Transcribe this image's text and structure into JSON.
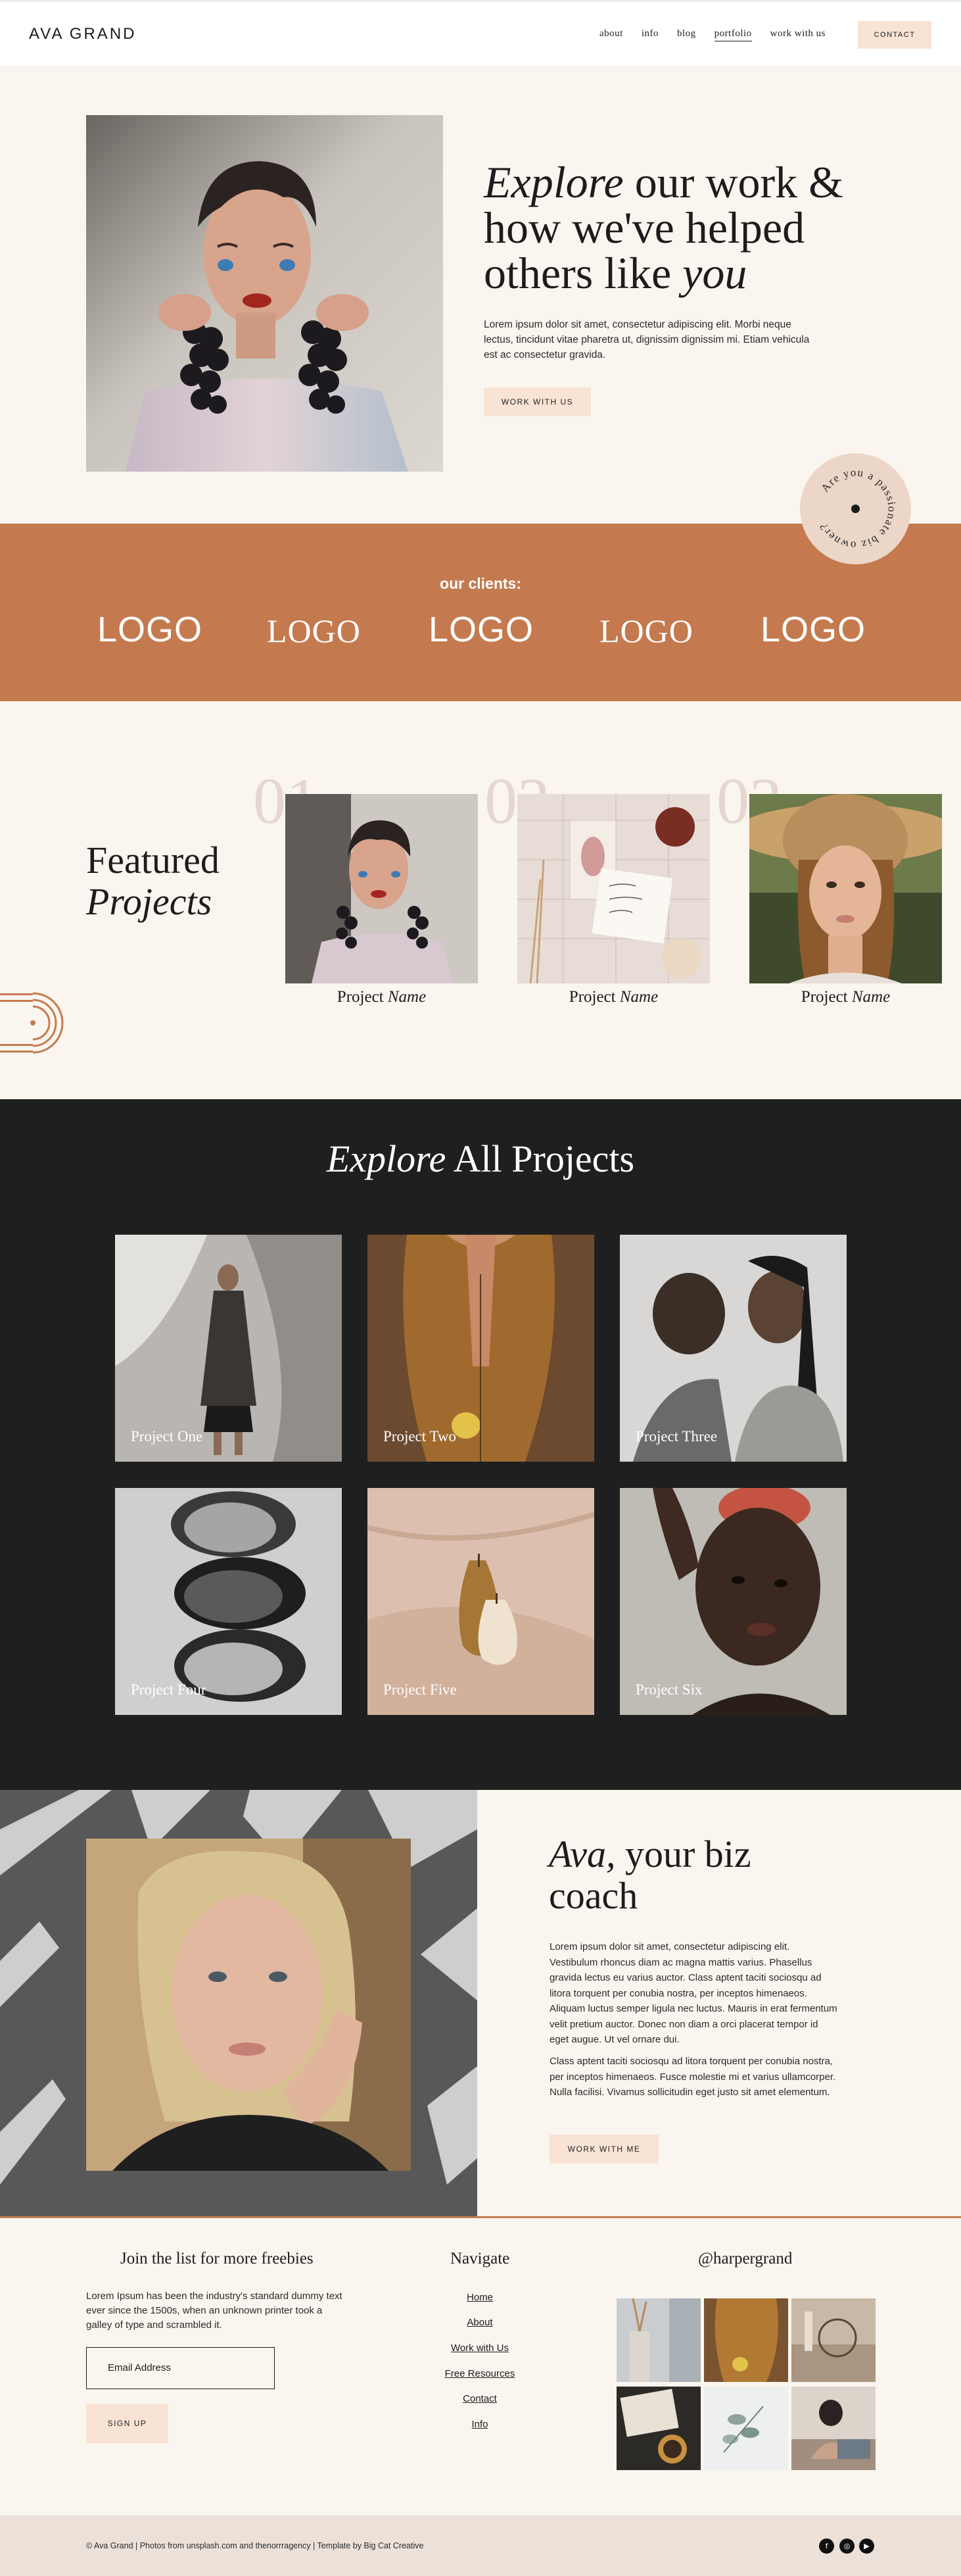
{
  "header": {
    "brand": "AVA GRAND",
    "nav": [
      "about",
      "info",
      "blog",
      "portfolio",
      "work with us"
    ],
    "active_nav": "portfolio",
    "contact_label": "CONTACT"
  },
  "hero": {
    "title_italic_1": "Explore",
    "title_line_1": " our work &",
    "title_line_2": "how we've helped",
    "title_line_3": "others like ",
    "title_italic_2": "you",
    "paragraph": "Lorem ipsum dolor sit amet, consectetur adipiscing elit. Morbi neque lectus, tincidunt vitae pharetra ut, dignissim dignissim mi. Etiam vehicula est ac consectetur gravida.",
    "button_label": "WORK WITH US",
    "badge_text": "Are you a passionate biz owner?"
  },
  "clients": {
    "title": "our clients:",
    "logos": [
      "LOGO",
      "LOGO",
      "LOGO",
      "LOGO",
      "LOGO"
    ]
  },
  "featured": {
    "title_line_1": "Featured",
    "title_line_2": "Projects",
    "items": [
      {
        "num": "01",
        "label": "Project ",
        "label_italic": "Name"
      },
      {
        "num": "02",
        "label": "Project ",
        "label_italic": "Name"
      },
      {
        "num": "03",
        "label": "Project ",
        "label_italic": "Name"
      }
    ]
  },
  "explore": {
    "title_italic": "Explore",
    "title_rest": " All Projects",
    "projects": [
      "Project One",
      "Project Two",
      "Project Three",
      "Project Four",
      "Project Five",
      "Project Six"
    ]
  },
  "coach": {
    "title_italic": "Ava,",
    "title_rest": " your biz",
    "title_line_2": "coach",
    "paragraph_1": "Lorem ipsum dolor sit amet, consectetur adipiscing elit. Vestibulum rhoncus diam ac magna mattis varius. Phasellus gravida lectus eu varius auctor. Class aptent taciti sociosqu ad litora torquent per conubia nostra, per inceptos himenaeos. Aliquam luctus semper ligula nec luctus. Mauris in erat fermentum velit pretium auctor. Donec non diam a orci placerat tempor id eget augue. Ut vel ornare dui.",
    "paragraph_2": "Class aptent taciti sociosqu ad litora torquent per conubia nostra, per inceptos himenaeos. Fusce molestie mi et varius ullamcorper. Nulla facilisi. Vivamus sollicitudin eget justo sit amet elementum.",
    "button_label": "WORK WITH ME"
  },
  "footer": {
    "newsletter_title": "Join the list for more freebies",
    "newsletter_text": "Lorem Ipsum has been the industry's standard dummy text ever since the 1500s, when an unknown printer took a galley of type and scrambled it.",
    "email_placeholder": "Email Address",
    "signup_label": "SIGN UP",
    "navigate_title": "Navigate",
    "nav_links": [
      "Home",
      "About",
      "Work with Us",
      "Free Resources",
      "Contact",
      "Info"
    ],
    "instagram_title": "@harpergrand",
    "copyright": "© Ava Grand  |  Photos from unsplash.com and thenorrragency  |  Template by Big Cat Creative",
    "social_icons": [
      "facebook-icon",
      "instagram-icon",
      "youtube-icon"
    ]
  }
}
